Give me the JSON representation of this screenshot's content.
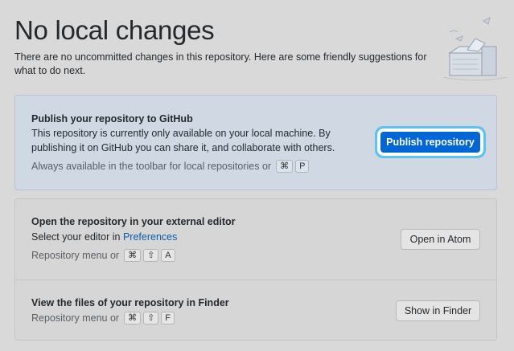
{
  "header": {
    "title": "No local changes",
    "description": "There are no uncommitted changes in this repository. Here are some friendly suggestions for what to do next."
  },
  "publish": {
    "title": "Publish your repository to GitHub",
    "description": "This repository is currently only available on your local machine. By publishing it on GitHub you can share it, and collaborate with others.",
    "hint": "Always available in the toolbar for local repositories or",
    "keys": [
      "⌘",
      "P"
    ],
    "button_label": "Publish repository"
  },
  "editor": {
    "title": "Open the repository in your external editor",
    "text_prefix": "Select your editor in",
    "link_label": "Preferences",
    "hint": "Repository menu or",
    "keys": [
      "⌘",
      "⇧",
      "A"
    ],
    "button_label": "Open in Atom"
  },
  "finder": {
    "title": "View the files of your repository in Finder",
    "hint": "Repository menu or",
    "keys": [
      "⌘",
      "⇧",
      "F"
    ],
    "button_label": "Show in Finder"
  },
  "colors": {
    "accent": "#0366d6",
    "focus_ring": "#5ec2ef",
    "publish_bg": "#cfd8e3"
  }
}
